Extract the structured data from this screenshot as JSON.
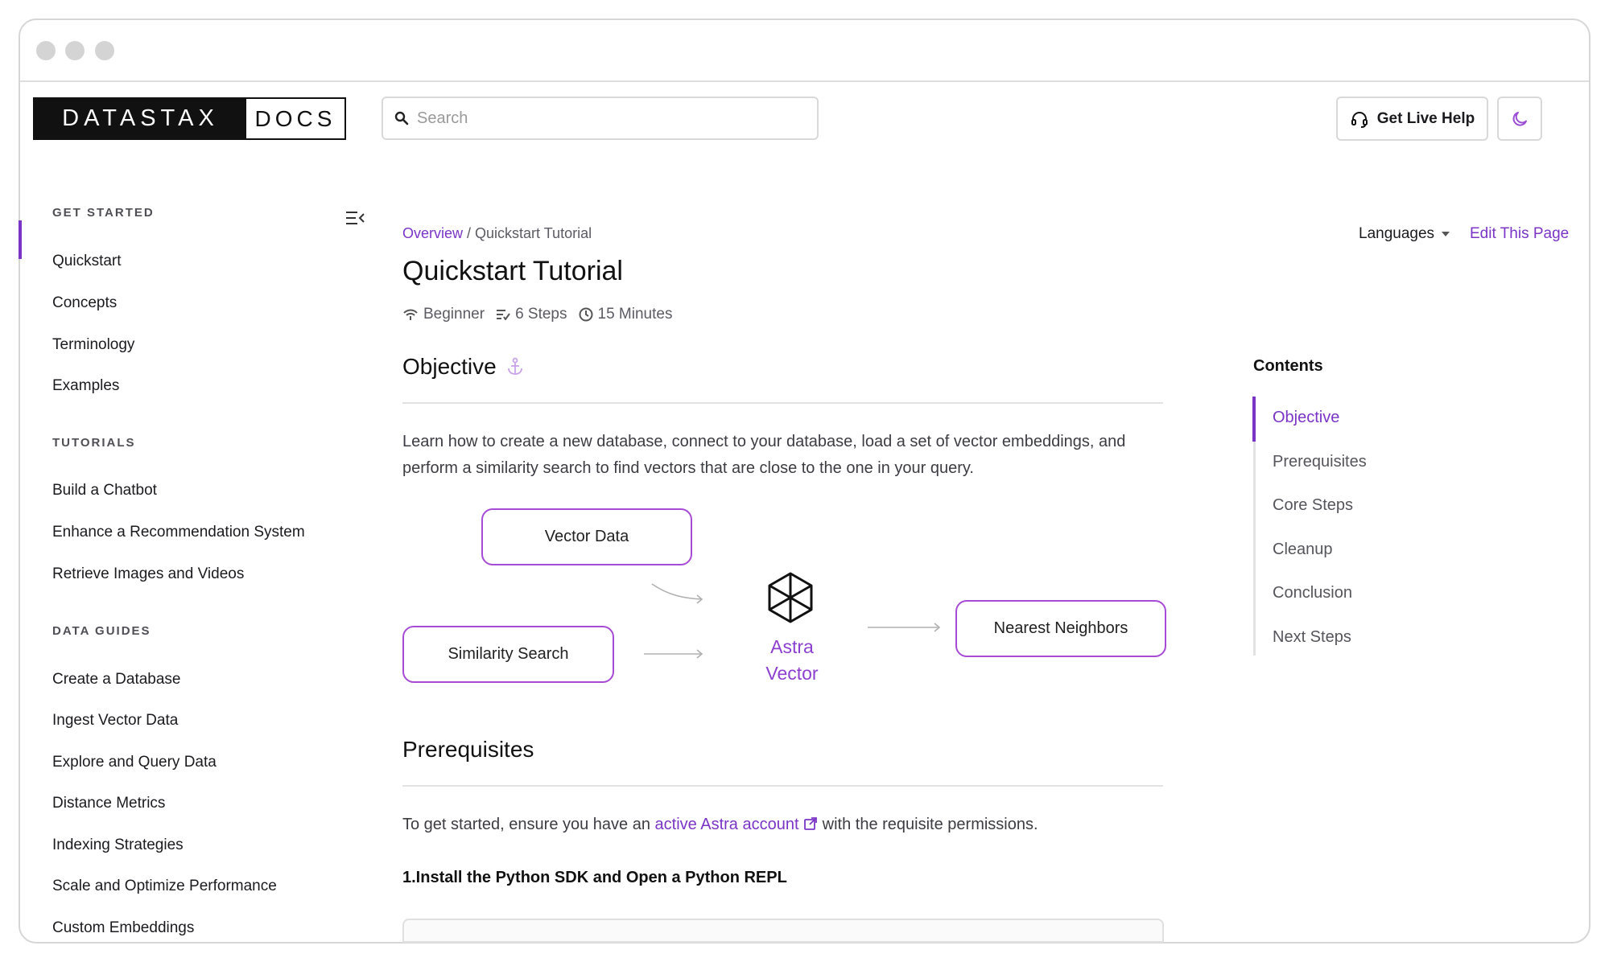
{
  "colors": {
    "accent": "#7b35c6",
    "diagram_border": "#a74bd6",
    "text": "#1b1b1f",
    "muted": "#5b5b63"
  },
  "header": {
    "logo_left": "DATASTAX",
    "logo_right": "DOCS",
    "search_placeholder": "Search",
    "help_label": "Get Live Help",
    "help_icon": "headset-icon",
    "theme_icon": "moon-icon"
  },
  "sidebar": {
    "sections": [
      {
        "title": "GET STARTED",
        "items": [
          "Quickstart",
          "Concepts",
          "Terminology",
          "Examples"
        ]
      },
      {
        "title": "TUTORIALS",
        "items": [
          "Build a Chatbot",
          "Enhance a Recommendation System",
          "Retrieve Images and Videos"
        ]
      },
      {
        "title": "DATA GUIDES",
        "items": [
          "Create a Database",
          "Ingest Vector Data",
          "Explore and Query Data",
          "Distance Metrics",
          "Indexing Strategies",
          "Scale and Optimize Performance",
          "Custom Embeddings"
        ]
      }
    ],
    "active_item": "Quickstart"
  },
  "breadcrumb": {
    "link": "Overview",
    "separator": " / ",
    "current": "Quickstart Tutorial"
  },
  "topright": {
    "languages": "Languages",
    "edit": "Edit This Page"
  },
  "page": {
    "title": "Quickstart Tutorial",
    "meta": {
      "level": "Beginner",
      "steps": "6 Steps",
      "time": "15 Minutes"
    },
    "objective_heading": "Objective",
    "objective_text": "Learn how to create a new database, connect to your database, load a set of vector embeddings, and perform a similarity search to find vectors that are close to the one in your query.",
    "diagram": {
      "vector_data": "Vector Data",
      "similarity_search": "Similarity Search",
      "astra_line1": "Astra",
      "astra_line2": "Vector",
      "nearest_neighbors": "Nearest Neighbors"
    },
    "prereq_heading": "Prerequisites",
    "prereq_text_before": "To get started, ensure you have an ",
    "prereq_link": "active Astra account",
    "prereq_text_after": " with the requisite permissions.",
    "step1": "1.Install the Python SDK and Open a Python REPL"
  },
  "toc": {
    "title": "Contents",
    "items": [
      "Objective",
      "Prerequisites",
      "Core Steps",
      "Cleanup",
      "Conclusion",
      "Next Steps"
    ],
    "active": "Objective"
  }
}
